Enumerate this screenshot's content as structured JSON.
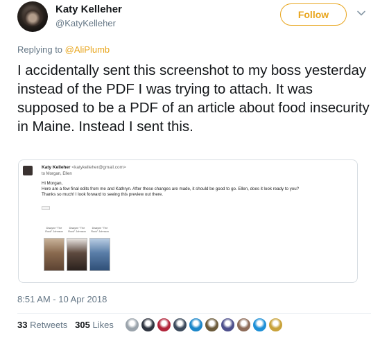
{
  "user": {
    "display_name": "Katy Kelleher",
    "handle": "@KatyKelleher"
  },
  "follow_label": "Follow",
  "reply": {
    "prefix": "Replying to ",
    "mention": "@AliPlumb"
  },
  "tweet_text": "I accidentally sent this screenshot to my boss yesterday instead of the PDF I was trying to attach. It was supposed to be a PDF of an article about food insecurity in Maine. Instead I sent this.",
  "email": {
    "sender_name": "Katy Kelleher",
    "sender_address": "<katykelleher@gmail.com>",
    "to_line": "to Morgan, Ellen",
    "body": [
      "Hi Morgan,",
      "Here are a few final edits from me and Kathryn. After these changes are made, it should be good to go. Ellen, does it look ready to you?",
      "Thanks so much! I look forward to seeing this preview out there."
    ],
    "thumbnails": [
      {
        "caption": "Dwayne \"The Rock\" Johnson",
        "color": "#8a6a4f"
      },
      {
        "caption": "Dwayne \"The Rock\" Johnson",
        "color": "#5e4a3f"
      },
      {
        "caption": "Dwayne \"The Rock\" Johnson",
        "color": "#5a7ea8"
      }
    ]
  },
  "timestamp": "8:51 AM - 10 Apr 2018",
  "stats": {
    "retweets_count": "33",
    "retweets_label": "Retweets",
    "likes_count": "305",
    "likes_label": "Likes"
  },
  "colors": {
    "accent": "#e8a51c",
    "muted": "#657786",
    "text": "#14171a"
  },
  "liker_avatars": [
    "#9aa3ab",
    "#2f3540",
    "#b1243a",
    "#3c4a5c",
    "#1b86c9",
    "#6b5a3a",
    "#4d4f8c",
    "#8d6b58",
    "#1d8fd6",
    "#c8a23a"
  ]
}
